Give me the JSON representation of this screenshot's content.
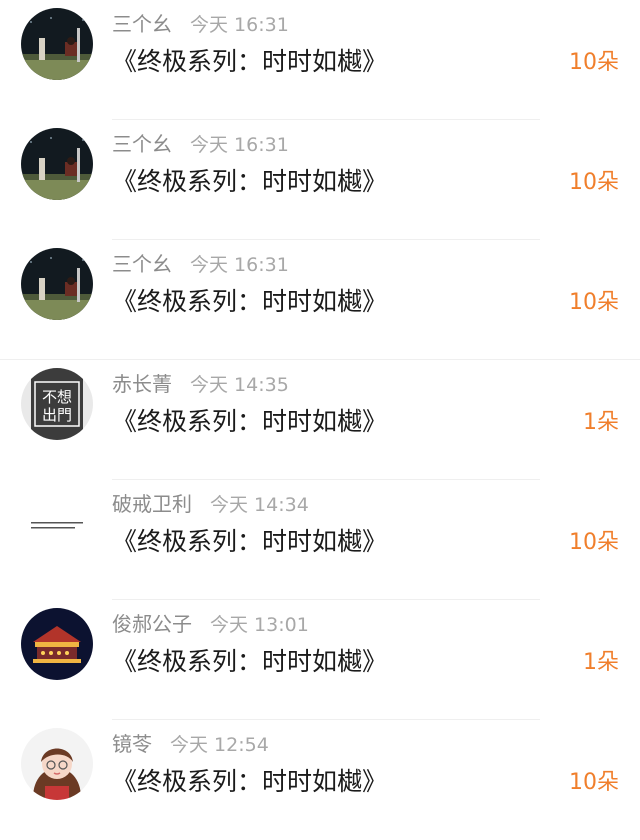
{
  "rows": [
    {
      "name": "三个幺",
      "time": "今天 16:31",
      "message": "《终极系列：时时如樾》",
      "gift": "10朵",
      "avatar": "night-field-scene"
    },
    {
      "name": "三个幺",
      "time": "今天 16:31",
      "message": "《终极系列：时时如樾》",
      "gift": "10朵",
      "avatar": "night-field-scene"
    },
    {
      "name": "三个幺",
      "time": "今天 16:31",
      "message": "《终极系列：时时如樾》",
      "gift": "10朵",
      "avatar": "night-field-scene"
    },
    {
      "name": "赤长菁",
      "time": "今天 14:35",
      "message": "《终极系列：时时如樾》",
      "gift": "1朵",
      "avatar": "calligraphy-avatar",
      "avatar_text": [
        "不想",
        "出門"
      ]
    },
    {
      "name": "破戒卫利",
      "time": "今天 14:34",
      "message": "《终极系列：时时如樾》",
      "gift": "10朵",
      "avatar": "tiny-text-avatar"
    },
    {
      "name": "俊郝公子",
      "time": "今天 13:01",
      "message": "《终极系列：时时如樾》",
      "gift": "1朵",
      "avatar": "carousel-avatar"
    },
    {
      "name": "镜苓",
      "time": "今天 12:54",
      "message": "《终极系列：时时如樾》",
      "gift": "10朵",
      "avatar": "girl-portrait-avatar"
    }
  ],
  "colors": {
    "gift": "#f07f2c",
    "name": "#8c8c8c",
    "time": "#a8a8a8",
    "message": "#1b1b1b",
    "divider": "#efefef"
  }
}
